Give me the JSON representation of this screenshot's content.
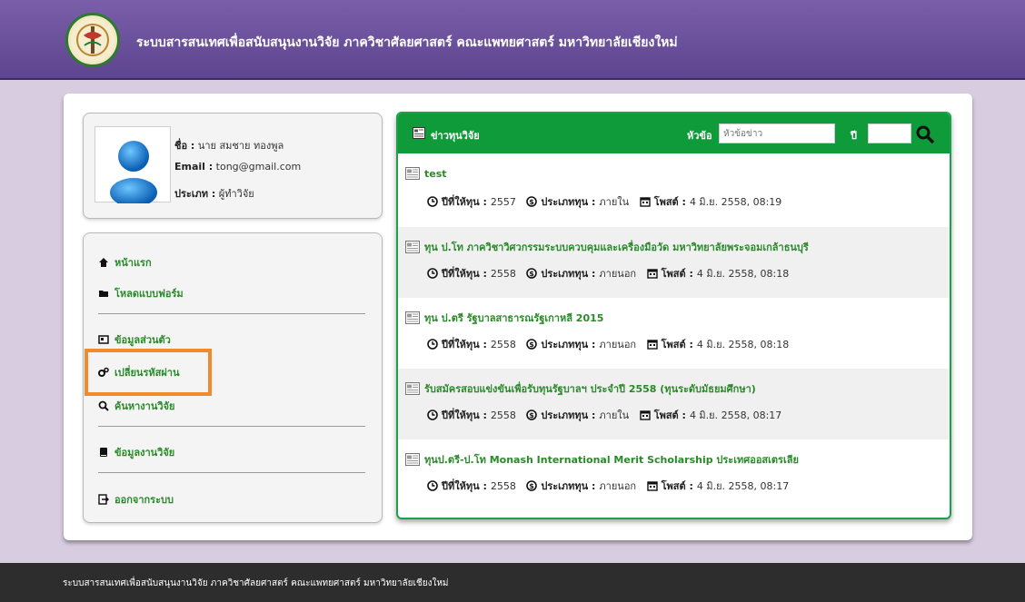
{
  "header": {
    "title": "ระบบสารสนเทศเพื่อสนับสนุนงานวิจัย ภาควิชาศัลยศาสตร์ คณะแพทยศาสตร์ มหาวิทยาลัยเชียงใหม่"
  },
  "profile": {
    "name_label": "ชื่อ :",
    "name_value": "นาย สมชาย ทองพูล",
    "email_label": "Email :",
    "email_value": "tong@gmail.com",
    "type_label": "ประเภท :",
    "type_value": "ผู้ทำวิจัย"
  },
  "menu": {
    "home": "หน้าแรก",
    "download_forms": "โหลดแบบฟอร์ม",
    "personal_info": "ข้อมูลส่วนตัว",
    "change_password": "เปลี่ยนรหัสผ่าน",
    "search_research": "ค้นหางานวิจัย",
    "research_data": "ข้อมูลงานวิจัย",
    "logout": "ออกจากระบบ"
  },
  "news": {
    "title": "ข่าวทุนวิจัย",
    "topic_label": "หัวข้อ",
    "topic_placeholder": "หัวข้อข่าว",
    "year_label": "ปี",
    "year_value": "",
    "meta_labels": {
      "year": "ปีที่ให้ทุน :",
      "type": "ประเภททุน :",
      "posted": "โพสต์ :"
    },
    "items": [
      {
        "title": "test",
        "year": "2557",
        "type": "ภายใน",
        "posted": "4 มิ.ย. 2558, 08:19"
      },
      {
        "title": "ทุน ป.โท ภาควิชาวิศวกรรมระบบควบคุมและเครื่องมือวัด มหาวิทยาลัยพระจอมเกล้าธนบุรี",
        "year": "2558",
        "type": "ภายนอก",
        "posted": "4 มิ.ย. 2558, 08:18"
      },
      {
        "title": "ทุน ป.ตรี รัฐบาลสาธารณรัฐเกาหลี 2015",
        "year": "2558",
        "type": "ภายนอก",
        "posted": "4 มิ.ย. 2558, 08:18"
      },
      {
        "title": "รับสมัครสอบแข่งขันเพื่อรับทุนรัฐบาลฯ ประจำปี 2558 (ทุนระดับมัธยมศึกษา)",
        "year": "2558",
        "type": "ภายใน",
        "posted": "4 มิ.ย. 2558, 08:17"
      },
      {
        "title": "ทุนป.ตรี-ป.โท Monash International Merit Scholarship ประเทศออสเตรเลีย",
        "year": "2558",
        "type": "ภายนอก",
        "posted": "4 มิ.ย. 2558, 08:17"
      }
    ]
  },
  "footer": {
    "text": "ระบบสารสนเทศเพื่อสนับสนุนงานวิจัย ภาควิชาศัลยศาสตร์ คณะแพทยศาสตร์ มหาวิทยาลัยเชียงใหม่"
  },
  "colors": {
    "header": "#6b4f9e",
    "accent_green": "#0f9b3a",
    "link_green": "#2a8a2a",
    "highlight": "#f08a2c",
    "footer": "#2d2d2d"
  }
}
